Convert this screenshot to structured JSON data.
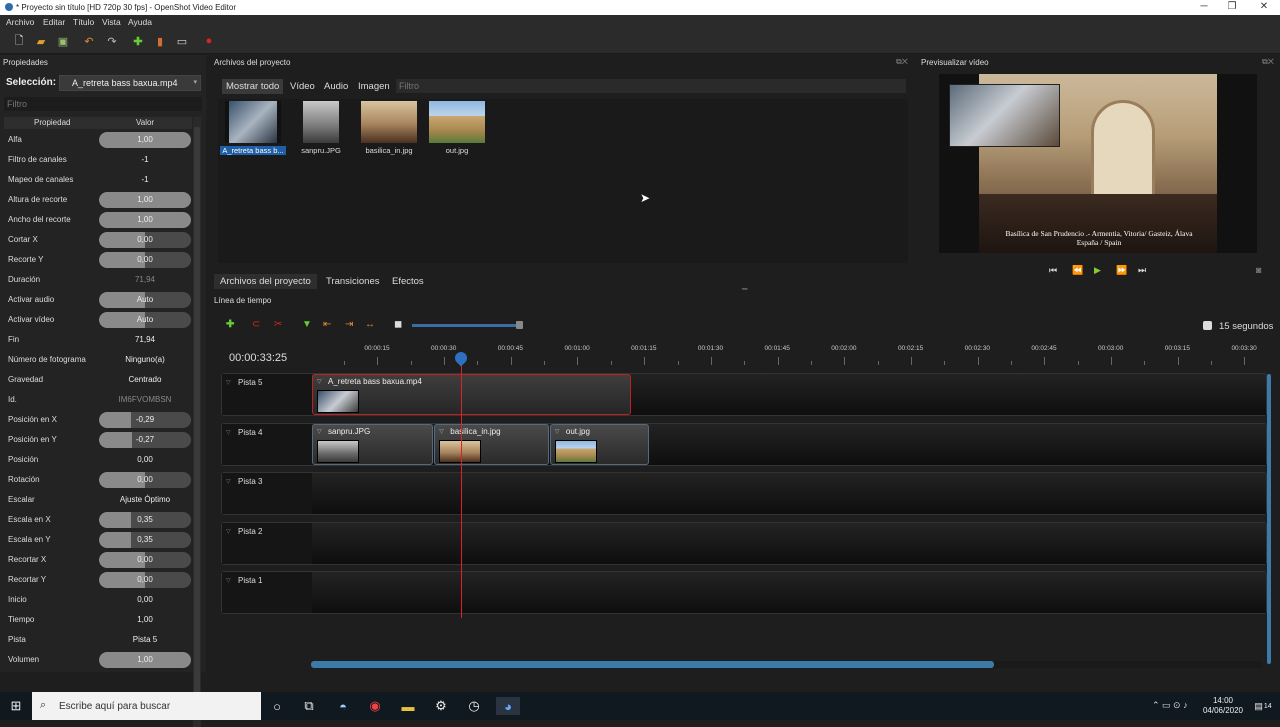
{
  "window": {
    "title": "* Proyecto sin título [HD 720p 30 fps] - OpenShot Video Editor",
    "min": "─",
    "max": "❐",
    "close": "✕"
  },
  "menu": [
    "Archivo",
    "Editar",
    "Título",
    "Vista",
    "Ayuda"
  ],
  "properties": {
    "panel_title": "Propiedades",
    "selection_label": "Selección:",
    "selection_value": "A_retreta bass baxua.mp4",
    "filter_placeholder": "Filtro",
    "col_property": "Propiedad",
    "col_value": "Valor",
    "rows": [
      {
        "name": "Alfa",
        "value": "1,00",
        "fill": 1.0
      },
      {
        "name": "Filtro de canales",
        "value": "-1",
        "fill": 0
      },
      {
        "name": "Mapeo de canales",
        "value": "-1",
        "fill": 0
      },
      {
        "name": "Altura de recorte",
        "value": "1,00",
        "fill": 1.0
      },
      {
        "name": "Ancho del recorte",
        "value": "1,00",
        "fill": 1.0
      },
      {
        "name": "Cortar X",
        "value": "0,00",
        "fill": 0.5
      },
      {
        "name": "Recorte Y",
        "value": "0,00",
        "fill": 0.5
      },
      {
        "name": "Duración",
        "value": "71,94",
        "fill": -1
      },
      {
        "name": "Activar audio",
        "value": "Auto",
        "fill": 0.5
      },
      {
        "name": "Activar vídeo",
        "value": "Auto",
        "fill": 0.5
      },
      {
        "name": "Fin",
        "value": "71,94",
        "fill": 0
      },
      {
        "name": "Número de fotograma",
        "value": "Ninguno(a)",
        "fill": 0
      },
      {
        "name": "Gravedad",
        "value": "Centrado",
        "fill": 0
      },
      {
        "name": "Id.",
        "value": "IM6FVOMBSN",
        "fill": -1
      },
      {
        "name": "Posición en X",
        "value": "-0,29",
        "fill": 0.35
      },
      {
        "name": "Posición en Y",
        "value": "-0,27",
        "fill": 0.36
      },
      {
        "name": "Posición",
        "value": "0,00",
        "fill": 0
      },
      {
        "name": "Rotación",
        "value": "0,00",
        "fill": 0.5
      },
      {
        "name": "Escalar",
        "value": "Ajuste Óptimo",
        "fill": 0
      },
      {
        "name": "Escala en X",
        "value": "0,35",
        "fill": 0.35
      },
      {
        "name": "Escala en Y",
        "value": "0,35",
        "fill": 0.35
      },
      {
        "name": "Recortar X",
        "value": "0,00",
        "fill": 0.5
      },
      {
        "name": "Recortar Y",
        "value": "0,00",
        "fill": 0.5
      },
      {
        "name": "Inicio",
        "value": "0,00",
        "fill": 0
      },
      {
        "name": "Tiempo",
        "value": "1,00",
        "fill": 0
      },
      {
        "name": "Pista",
        "value": "Pista 5",
        "fill": 0
      },
      {
        "name": "Volumen",
        "value": "1,00",
        "fill": 1.0
      }
    ]
  },
  "files": {
    "panel_title": "Archivos del proyecto",
    "tabs": [
      "Mostrar todo",
      "Vídeo",
      "Audio",
      "Imagen"
    ],
    "filter_placeholder": "Filtro",
    "items": [
      {
        "label": "A_retreta bass b...",
        "selected": true
      },
      {
        "label": "sanpru.JPG",
        "selected": false
      },
      {
        "label": "basilica_in.jpg",
        "selected": false
      },
      {
        "label": "out.jpg",
        "selected": false
      }
    ],
    "bottom_tabs": [
      "Archivos del proyecto",
      "Transiciones",
      "Efectos"
    ]
  },
  "preview": {
    "panel_title": "Previsualizar vídeo",
    "caption_line1": "Basílica de San Prudencio .- Armentia, Vitoria/ Gasteiz, Álava",
    "caption_line2": "España / Spain"
  },
  "timeline": {
    "panel_title": "Línea de tiempo",
    "timecode": "00:00:33:25",
    "zoom_label": "15 segundos",
    "zoom_level": 0.95,
    "ruler": [
      "00:00:15",
      "00:00:30",
      "00:00:45",
      "00:01:00",
      "00:01:15",
      "00:01:30",
      "00:01:45",
      "00:02:00",
      "00:02:15",
      "00:02:30",
      "00:02:45",
      "00:03:00",
      "00:03:15",
      "00:03:30"
    ],
    "tracks": [
      {
        "name": "Pista 5",
        "clips": [
          {
            "name": "A_retreta bass baxua.mp4",
            "start": 0,
            "end": 71.94,
            "selected": true,
            "thumb": "video"
          }
        ]
      },
      {
        "name": "Pista 4",
        "clips": [
          {
            "name": "sanpru.JPG",
            "start": 0,
            "end": 27.5,
            "selected": false,
            "thumb": "sanpru"
          },
          {
            "name": "basilica_in.jpg",
            "start": 27.5,
            "end": 53.5,
            "selected": false,
            "thumb": "basilica"
          },
          {
            "name": "out.jpg",
            "start": 53.5,
            "end": 76,
            "selected": false,
            "thumb": "out"
          }
        ]
      },
      {
        "name": "Pista 3",
        "clips": []
      },
      {
        "name": "Pista 2",
        "clips": []
      },
      {
        "name": "Pista 1",
        "clips": []
      }
    ],
    "playhead_seconds": 33.8
  },
  "taskbar": {
    "search_placeholder": "Escribe aquí para buscar",
    "time": "14:00",
    "date": "04/06/2020",
    "notifications": "14"
  },
  "colors": {
    "accent": "#2f6fc0",
    "selection": "#1f5fa8",
    "playhead": "#d22222"
  }
}
